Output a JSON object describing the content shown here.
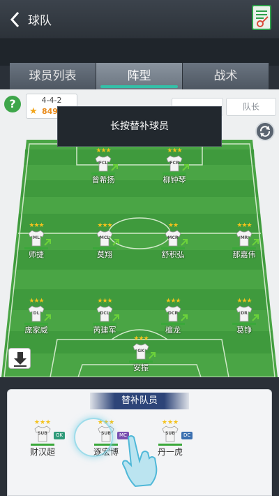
{
  "header": {
    "title": "球队"
  },
  "tabs": [
    {
      "label": "球员列表"
    },
    {
      "label": "阵型"
    },
    {
      "label": "战术"
    }
  ],
  "help_label": "?",
  "formation": {
    "name": "4-4-2",
    "rating": "849"
  },
  "captain_label": "队长",
  "tooltip_text": "长按替补球员",
  "colors": {
    "pitch_light": "#4fa84a",
    "pitch_dark": "#3d9a3c",
    "accent": "#34c0a8",
    "bar": "#3aa83a"
  },
  "players": [
    {
      "pos": "FCL",
      "name": "曾希扬",
      "stars": "★★★"
    },
    {
      "pos": "FCR",
      "name": "柳钟琴",
      "stars": "★★★"
    },
    {
      "pos": "ML",
      "name": "师捷",
      "stars": "★★★"
    },
    {
      "pos": "MCL",
      "name": "莫翔",
      "stars": "★★★"
    },
    {
      "pos": "MCR",
      "name": "舒积弘",
      "stars": "★★"
    },
    {
      "pos": "MR",
      "name": "那嘉伟",
      "stars": "★★★"
    },
    {
      "pos": "DL",
      "name": "庞家威",
      "stars": "★★★"
    },
    {
      "pos": "DCL",
      "name": "芮建军",
      "stars": "★★★"
    },
    {
      "pos": "DCR",
      "name": "檀龙",
      "stars": "★★★"
    },
    {
      "pos": "DR",
      "name": "葛铮",
      "stars": "★★★"
    },
    {
      "pos": "GK",
      "name": "安振",
      "stars": "★★★"
    }
  ],
  "substitutes": {
    "title": "替补队员",
    "items": [
      {
        "pos": "SUB",
        "tag": "GK",
        "tag_color": "#2f9a7a",
        "name": "财汉超",
        "stars": "★★★"
      },
      {
        "pos": "SUB",
        "tag": "MC",
        "tag_color": "#7a4fb0",
        "name": "逐宏博",
        "stars": "★★★"
      },
      {
        "pos": "SUB",
        "tag": "DC",
        "tag_color": "#3a6fb0",
        "name": "丹一虎",
        "stars": "★★★"
      }
    ]
  }
}
